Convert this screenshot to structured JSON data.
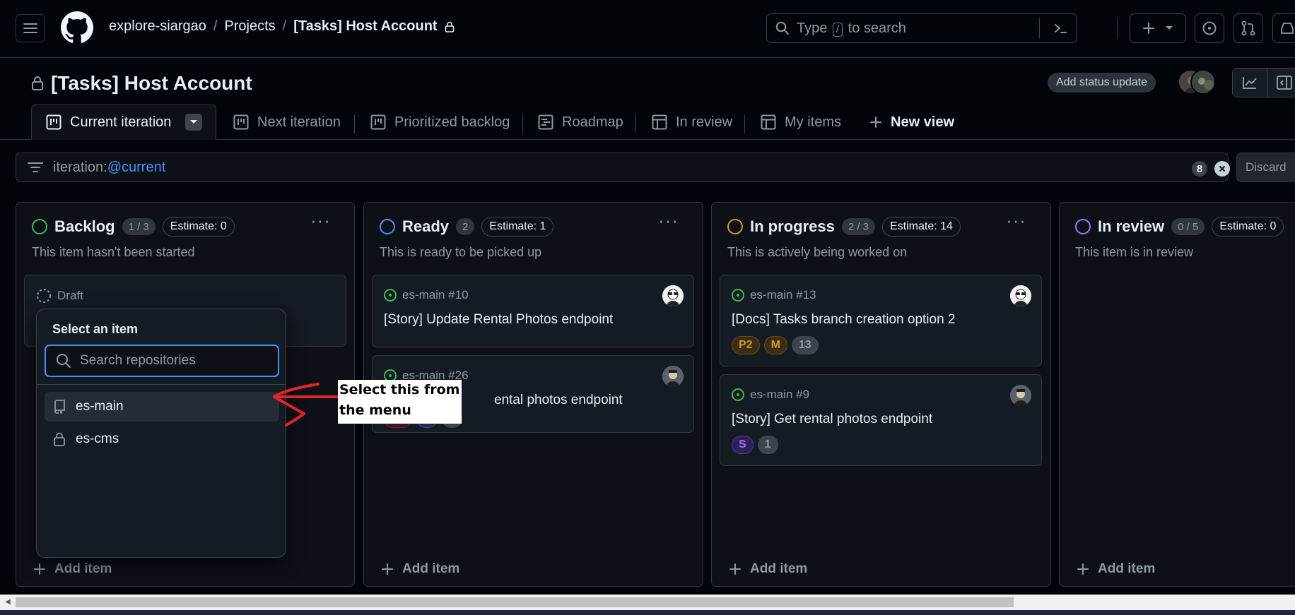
{
  "breadcrumb": {
    "org": "explore-siargao",
    "section": "Projects",
    "project": "[Tasks] Host Account"
  },
  "search": {
    "prefix": "Type",
    "key": "/",
    "suffix": "to search"
  },
  "project": {
    "title": "[Tasks] Host Account",
    "status_button": "Add status update"
  },
  "tabs": [
    {
      "label": "Current iteration",
      "icon": "board-icon"
    },
    {
      "label": "Next iteration",
      "icon": "board-icon"
    },
    {
      "label": "Prioritized backlog",
      "icon": "board-icon"
    },
    {
      "label": "Roadmap",
      "icon": "roadmap-icon"
    },
    {
      "label": "In review",
      "icon": "table-icon"
    },
    {
      "label": "My items",
      "icon": "table-icon"
    }
  ],
  "new_view_label": "New view",
  "filter": {
    "key": "iteration:",
    "value": "@current",
    "count": "8",
    "discard_label": "Discard"
  },
  "columns": [
    {
      "name": "Backlog",
      "count": "1 / 3",
      "estimate": "Estimate: 0",
      "description": "This item hasn't been started",
      "color": "#3fb950",
      "add_label": "Add item"
    },
    {
      "name": "Ready",
      "count": "2",
      "estimate": "Estimate: 1",
      "description": "This is ready to be picked up",
      "color": "#4493f8",
      "add_label": "Add item"
    },
    {
      "name": "In progress",
      "count": "2 / 3",
      "estimate": "Estimate: 14",
      "description": "This is actively being worked on",
      "color": "#d29922",
      "add_label": "Add item"
    },
    {
      "name": "In review",
      "count": "0 / 5",
      "estimate": "Estimate: 0",
      "description": "This item is in review",
      "color": "#a371f7",
      "add_label": "Add item"
    }
  ],
  "backlog_draft": {
    "label": "Draft"
  },
  "cards": {
    "ready_1": {
      "ref": "es-main #10",
      "title": "[Story] Update Rental Photos endpoint"
    },
    "ready_2": {
      "ref": "es-main #26",
      "title": "ental photos endpoint",
      "labels": [
        "P0",
        "S",
        "1"
      ]
    },
    "progress_1": {
      "ref": "es-main #13",
      "title": "[Docs] Tasks branch creation option 2",
      "labels": [
        "P2",
        "M",
        "13"
      ]
    },
    "progress_2": {
      "ref": "es-main #9",
      "title": "[Story] Get rental photos endpoint",
      "labels": [
        "S",
        "1"
      ]
    }
  },
  "popup": {
    "title": "Select an item",
    "search_placeholder": "Search repositories",
    "items": [
      {
        "label": "es-main",
        "icon": "repo-icon"
      },
      {
        "label": "es-cms",
        "icon": "lock-icon"
      }
    ]
  },
  "annotation": {
    "line1": "Select this from",
    "line2": "the menu",
    "arrow_color": "#e0242b"
  }
}
